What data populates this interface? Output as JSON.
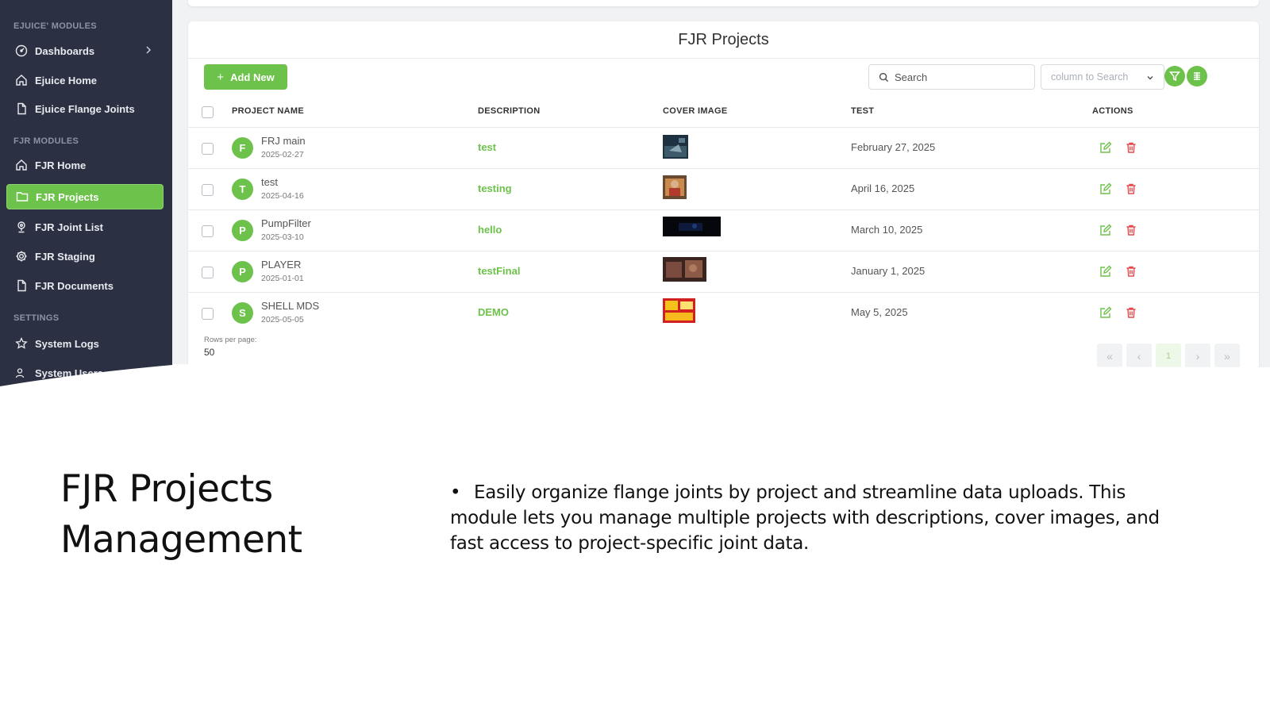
{
  "sidebar": {
    "sections": [
      "Ejuice' Modules",
      "FJR Modules",
      "Settings"
    ],
    "items": [
      {
        "label": "Dashboards",
        "icon": "dashboard-icon"
      },
      {
        "label": "Ejuice Home",
        "icon": "home-icon"
      },
      {
        "label": "Ejuice Flange Joints",
        "icon": "file-icon"
      },
      {
        "label": "FJR Home",
        "icon": "home-icon"
      },
      {
        "label": "FJR Projects",
        "icon": "folder-icon",
        "active": true
      },
      {
        "label": "FJR Joint List",
        "icon": "location-icon"
      },
      {
        "label": "FJR Staging",
        "icon": "gear-icon"
      },
      {
        "label": "FJR Documents",
        "icon": "file-icon"
      },
      {
        "label": "System Logs",
        "icon": "star-icon"
      },
      {
        "label": "System Users",
        "icon": "users-icon"
      }
    ]
  },
  "card": {
    "title": "FJR Projects",
    "add_label": "Add New",
    "search_placeholder": "Search",
    "column_placeholder": "column to Search"
  },
  "table": {
    "headers": [
      "PROJECT NAME",
      "DESCRIPTION",
      "COVER IMAGE",
      "TEST",
      "ACTIONS"
    ],
    "rows": [
      {
        "initial": "F",
        "name": "FRJ main",
        "date": "2025-02-27",
        "description": "test",
        "test": "February 27, 2025"
      },
      {
        "initial": "T",
        "name": "test",
        "date": "2025-04-16",
        "description": "testing",
        "test": "April 16, 2025"
      },
      {
        "initial": "P",
        "name": "PumpFilter",
        "date": "2025-03-10",
        "description": "hello",
        "test": "March 10, 2025"
      },
      {
        "initial": "P",
        "name": "PLAYER",
        "date": "2025-01-01",
        "description": "testFinal",
        "test": "January 1, 2025"
      },
      {
        "initial": "S",
        "name": "SHELL MDS",
        "date": "2025-05-05",
        "description": "DEMO",
        "test": "May 5, 2025"
      }
    ]
  },
  "pagination": {
    "rows_per_page_label": "Rows per page:",
    "rows_per_page_value": "50",
    "first": "«",
    "prev": "‹",
    "current": "1",
    "next": "›",
    "last": "»"
  },
  "slide": {
    "title": "FJR Projects Management",
    "bullet": "•",
    "body": "Easily organize flange joints by project and streamline data uploads. This module lets you manage multiple projects with descriptions, cover images, and fast access to project-specific joint data."
  },
  "colors": {
    "accent": "#6cc24a",
    "sidebar_bg": "#2b3142",
    "delete": "#e5484d"
  }
}
